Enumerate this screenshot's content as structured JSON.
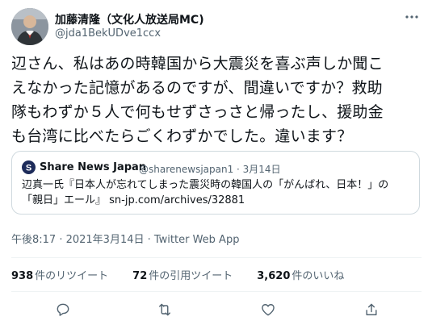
{
  "author": {
    "name": "加藤清隆（文化人放送局MC)",
    "handle": "@jda1BekUDve1ccx"
  },
  "tweet": {
    "lines": [
      "辺さん、私はあの時韓国から大震災を喜ぶ声しか聞こ",
      "えなかった記憶があるのですが、間違いですか？救助",
      "隊もわずか５人で何もせずさっさと帰ったし、援助金",
      "も台湾に比べたらごくわずかでした。違います？"
    ]
  },
  "quote": {
    "source_name": "Share News Japan",
    "meta": "@sharenewsjapan1 · 3月14日",
    "body_line1": "辺真一氏『日本人が忘れてしまった震災時の韓国人の「がんばれ、日本！」の",
    "body_line2_text": "「親日」エール』 ",
    "body_line2_link": "sn-jp.com/archives/32881"
  },
  "timestamp": "午後8:17 · 2021年3月14日 · Twitter Web App",
  "stats": [
    {
      "count": "938",
      "label": "件のリツイート"
    },
    {
      "count": "72",
      "label": "件の引用ツイート"
    },
    {
      "count": "3,620",
      "label": "件のいいね"
    }
  ],
  "colors": {
    "text": "#0f1419",
    "secondary": "#536471",
    "border": "#cfd9de",
    "divider": "#eff3f4"
  },
  "icons": [
    "more-icon",
    "share-news-logo-icon",
    "reply-icon",
    "retweet-icon",
    "like-icon",
    "share-icon"
  ]
}
